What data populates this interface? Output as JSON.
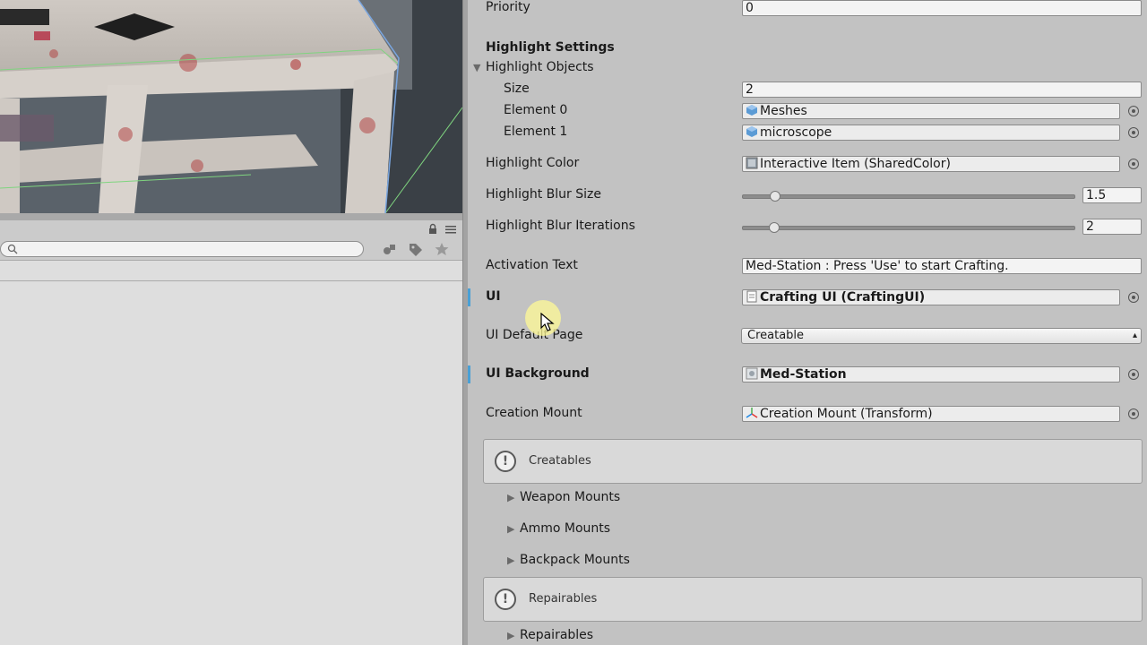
{
  "inspector": {
    "priority": {
      "label": "Priority",
      "value": "0"
    },
    "highlight_settings_header": "Highlight Settings",
    "highlight_objects": {
      "label": "Highlight Objects",
      "size_label": "Size",
      "size_value": "2",
      "elements": [
        {
          "label": "Element 0",
          "value": "Meshes",
          "icon": "prefab-cube-icon"
        },
        {
          "label": "Element 1",
          "value": "microscope",
          "icon": "prefab-cube-icon"
        }
      ]
    },
    "highlight_color": {
      "label": "Highlight Color",
      "value": "Interactive Item (SharedColor)"
    },
    "highlight_blur_size": {
      "label": "Highlight Blur Size",
      "value": "1.5",
      "slider_fraction": 0.05
    },
    "highlight_blur_iterations": {
      "label": "Highlight Blur Iterations",
      "value": "2",
      "slider_fraction": 0.05
    },
    "activation_text": {
      "label": "Activation Text",
      "value": "Med-Station : Press 'Use' to start Crafting."
    },
    "ui": {
      "label": "UI",
      "value": "Crafting UI (CraftingUI)"
    },
    "ui_default_page": {
      "label": "UI Default Page",
      "value": "Creatable"
    },
    "ui_background": {
      "label": "UI Background",
      "value": "Med-Station"
    },
    "creation_mount": {
      "label": "Creation Mount",
      "value": "Creation Mount (Transform)"
    },
    "creatables_help": "Creatables",
    "creatables_foldouts": [
      "Weapon Mounts",
      "Ammo Mounts",
      "Backpack Mounts"
    ],
    "repairables_help": "Repairables",
    "repairables_foldouts": [
      "Repairables"
    ]
  },
  "colors": {
    "modified_indicator": "#4aa0d5",
    "inspector_bg": "#c2c2c2",
    "field_bg": "#f3f3f3"
  }
}
